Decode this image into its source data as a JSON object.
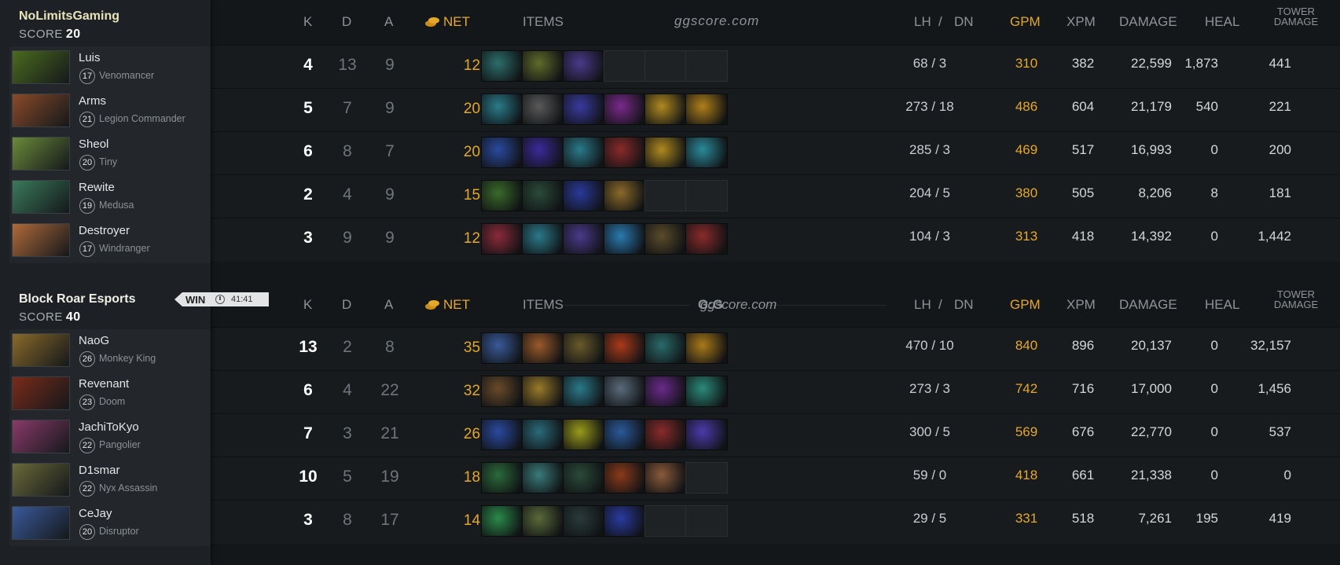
{
  "watermark": "ggscore.com",
  "watermark_logo": "G:G",
  "columns": {
    "k": "K",
    "d": "D",
    "a": "A",
    "net": "NET",
    "items": "ITEMS",
    "lh": "LH",
    "slash": "/",
    "dn": "DN",
    "gpm": "GPM",
    "xpm": "XPM",
    "damage": "DAMAGE",
    "heal": "HEAL",
    "tower1": "TOWER",
    "tower2": "DAMAGE"
  },
  "score_label": "SCORE",
  "win_badge": {
    "label": "WIN",
    "time": "41:41"
  },
  "teams": [
    {
      "name": "NoLimitsGaming",
      "score": "20",
      "players": [
        {
          "name": "Luis",
          "level": "17",
          "hero": "Venomancer",
          "k": "4",
          "d": "13",
          "a": "9",
          "net": "12,279",
          "lhdn": "68 / 3",
          "gpm": "310",
          "xpm": "382",
          "damage": "22,599",
          "heal": "1,873",
          "tower": "441",
          "portrait": "#4a6b1e",
          "items": [
            "#2c6e6a",
            "#5f6b2a",
            "#4b3a8a",
            "empty",
            "empty",
            "empty"
          ]
        },
        {
          "name": "Arms",
          "level": "21",
          "hero": "Legion Commander",
          "k": "5",
          "d": "7",
          "a": "9",
          "net": "20,164",
          "lhdn": "273 / 18",
          "gpm": "486",
          "xpm": "604",
          "damage": "21,179",
          "heal": "540",
          "tower": "221",
          "portrait": "#8a4a2a",
          "items": [
            "#2a7b8a",
            "#5a5a5a",
            "#3a3aa0",
            "#7a2a8a",
            "#b08a20",
            "#b0801a"
          ]
        },
        {
          "name": "Sheol",
          "level": "20",
          "hero": "Tiny",
          "k": "6",
          "d": "8",
          "a": "7",
          "net": "20,020",
          "lhdn": "285 / 3",
          "gpm": "469",
          "xpm": "517",
          "damage": "16,993",
          "heal": "0",
          "tower": "200",
          "portrait": "#6a8a3a",
          "items": [
            "#2a4aa0",
            "#3a2a9a",
            "#2a7a8a",
            "#8a2a2a",
            "#b08a20",
            "#2a8a9a"
          ]
        },
        {
          "name": "Rewite",
          "level": "19",
          "hero": "Medusa",
          "k": "2",
          "d": "4",
          "a": "9",
          "net": "15,852",
          "lhdn": "204 / 5",
          "gpm": "380",
          "xpm": "505",
          "damage": "8,206",
          "heal": "8",
          "tower": "181",
          "portrait": "#3a7a5a",
          "items": [
            "#3a6a2a",
            "#2a4a3a",
            "#2a3a9a",
            "#8a6a2a",
            "empty",
            "empty"
          ]
        },
        {
          "name": "Destroyer",
          "level": "17",
          "hero": "Windranger",
          "k": "3",
          "d": "9",
          "a": "9",
          "net": "12,035",
          "lhdn": "104 / 3",
          "gpm": "313",
          "xpm": "418",
          "damage": "14,392",
          "heal": "0",
          "tower": "1,442",
          "portrait": "#b06a3a",
          "items": [
            "#8a2a3a",
            "#2a7a8a",
            "#4a3a8a",
            "#2a7ab0",
            "#5a4a2a",
            "#8a2a2a"
          ]
        }
      ]
    },
    {
      "name": "Block Roar Esports",
      "score": "40",
      "players": [
        {
          "name": "NaoG",
          "level": "26",
          "hero": "Monkey King",
          "k": "13",
          "d": "2",
          "a": "8",
          "net": "35,433",
          "lhdn": "470 / 10",
          "gpm": "840",
          "xpm": "896",
          "damage": "20,137",
          "heal": "0",
          "tower": "32,157",
          "portrait": "#8a6a2a",
          "items": [
            "#3a5a9a",
            "#9a5a2a",
            "#6a5a2a",
            "#aa3a1a",
            "#2a6a6a",
            "#aa7a1a"
          ]
        },
        {
          "name": "Revenant",
          "level": "23",
          "hero": "Doom",
          "k": "6",
          "d": "4",
          "a": "22",
          "net": "32,145",
          "lhdn": "273 / 3",
          "gpm": "742",
          "xpm": "716",
          "damage": "17,000",
          "heal": "0",
          "tower": "1,456",
          "portrait": "#7a2a1a",
          "items": [
            "#6a4a2a",
            "#9a7a2a",
            "#2a7a8a",
            "#5a6a7a",
            "#6a2a8a",
            "#2a8a7a"
          ]
        },
        {
          "name": "JachiToKyo",
          "level": "22",
          "hero": "Pangolier",
          "k": "7",
          "d": "3",
          "a": "21",
          "net": "26,104",
          "lhdn": "300 / 5",
          "gpm": "569",
          "xpm": "676",
          "damage": "22,770",
          "heal": "0",
          "tower": "537",
          "portrait": "#8a3a6a",
          "items": [
            "#2a4aa0",
            "#2a6a7a",
            "#9a9a1a",
            "#2a5a9a",
            "#8a2a2a",
            "#4a3aaa"
          ]
        },
        {
          "name": "D1smar",
          "level": "22",
          "hero": "Nyx Assassin",
          "k": "10",
          "d": "5",
          "a": "19",
          "net": "18,201",
          "lhdn": "59 / 0",
          "gpm": "418",
          "xpm": "661",
          "damage": "21,338",
          "heal": "0",
          "tower": "0",
          "portrait": "#6a6a3a",
          "items": [
            "#2a6a3a",
            "#3a7a7a",
            "#2a4a3a",
            "#8a3a1a",
            "#8a5a3a",
            "empty"
          ]
        },
        {
          "name": "CeJay",
          "level": "20",
          "hero": "Disruptor",
          "k": "3",
          "d": "8",
          "a": "17",
          "net": "14,042",
          "lhdn": "29 / 5",
          "gpm": "331",
          "xpm": "518",
          "damage": "7,261",
          "heal": "195",
          "tower": "419",
          "portrait": "#3a5a9a",
          "items": [
            "#2a8a4a",
            "#5a6a3a",
            "#2a3a3a",
            "#2a3aa0",
            "empty",
            "empty"
          ]
        }
      ]
    }
  ]
}
